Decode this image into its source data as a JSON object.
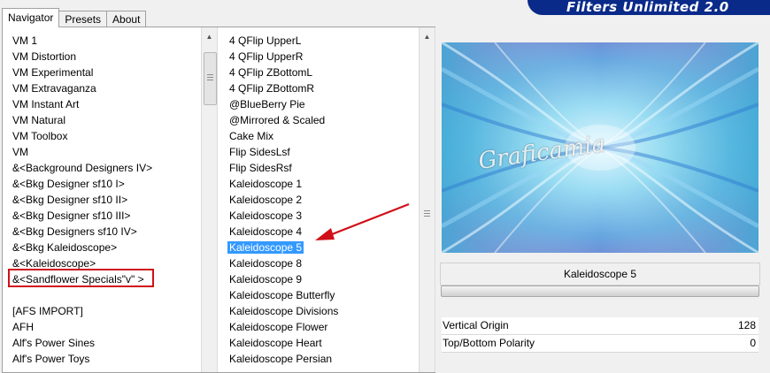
{
  "header": {
    "title": "Filters Unlimited 2.0"
  },
  "tabs": [
    {
      "label": "Navigator",
      "active": true
    },
    {
      "label": "Presets",
      "active": false
    },
    {
      "label": "About",
      "active": false
    }
  ],
  "categories": [
    "VM 1",
    "VM Distortion",
    "VM Experimental",
    "VM Extravaganza",
    "VM Instant Art",
    "VM Natural",
    "VM Toolbox",
    "VM",
    "&<Background Designers IV>",
    "&<Bkg Designer sf10 I>",
    "&<Bkg Designer sf10 II>",
    "&<Bkg Designer sf10 III>",
    "&<Bkg Designers sf10 IV>",
    "&<Bkg Kaleidoscope>",
    "&<Kaleidoscope>",
    "&<Sandflower Specials\"v\" >",
    "",
    "[AFS IMPORT]",
    "AFH",
    "Alf's Power Sines",
    "Alf's Power Toys"
  ],
  "highlighted_category_index": 13,
  "filters": [
    "4 QFlip UpperL",
    "4 QFlip UpperR",
    "4 QFlip ZBottomL",
    "4 QFlip ZBottomR",
    "@BlueBerry Pie",
    "@Mirrored & Scaled",
    "Cake Mix",
    "Flip SidesLsf",
    "Flip SidesRsf",
    "Kaleidoscope 1",
    "Kaleidoscope 2",
    "Kaleidoscope 3",
    "Kaleidoscope 4",
    "Kaleidoscope 5",
    "Kaleidoscope 8",
    "Kaleidoscope 9",
    "Kaleidoscope Butterfly",
    "Kaleidoscope Divisions",
    "Kaleidoscope Flower",
    "Kaleidoscope Heart",
    "Kaleidoscope Persian"
  ],
  "selected_filter_index": 13,
  "preview": {
    "watermark": "Graficamia"
  },
  "selected_filter_name": "Kaleidoscope 5",
  "params": [
    {
      "label": "Vertical Origin",
      "value": "128"
    },
    {
      "label": "Top/Bottom Polarity",
      "value": "0"
    }
  ],
  "colors": {
    "selection": "#3399ff",
    "highlight_box": "#d01018",
    "header_bar": "#0a2a8a"
  },
  "icons": {
    "annotation": "red-arrow",
    "scroll_up": "triangle-up-icon",
    "scroll_down": "triangle-down-icon"
  }
}
